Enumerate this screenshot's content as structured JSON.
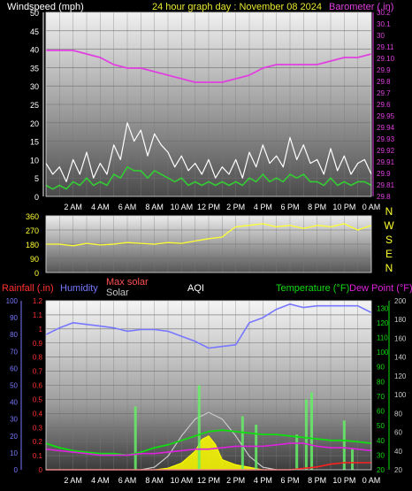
{
  "title": "24 hour graph day : November 08 2024",
  "colors": {
    "background": "#000000",
    "wind": "#ffffff",
    "wind_avg": "#33cc33",
    "barometer": "#e040e0",
    "direction": "#ffff33",
    "rain": "#ff2020",
    "humidity": "#7777ff",
    "max_solar": "#c8c8c8",
    "solar": "#ffff00",
    "aqi": "#ffffff",
    "temperature": "#11dd11",
    "dew_point": "#dd22dd",
    "uv_bar": "#66ee66"
  },
  "chart_data": [
    {
      "type": "line",
      "title": "24 hour graph day : November 08 2024",
      "left_axis_label": "Windspeed (mph)",
      "right_axis_label": "Barometer (.in)",
      "x_ticks": [
        "2 AM",
        "4 AM",
        "6 AM",
        "8 AM",
        "10 AM",
        "12 PM",
        "2 PM",
        "4 PM",
        "6 PM",
        "8 PM",
        "10 PM",
        "0 AM"
      ],
      "x_range_hours": [
        0,
        24
      ],
      "ylim_left": [
        0,
        50
      ],
      "yticks_left": [
        "0",
        "5",
        "10",
        "15",
        "20",
        "25",
        "30",
        "35",
        "40",
        "45",
        "50"
      ],
      "ylim_right": [
        29.8,
        30.3
      ],
      "yticks_right": [
        "29.8",
        "29.81",
        "29.9",
        "29.91",
        "29.92",
        "29.93",
        "29.94",
        "29.95",
        "29.6",
        "29.7",
        "29.8",
        "29.9",
        "29.10",
        "29.11",
        "30",
        "30.1",
        "30.2"
      ],
      "series": [
        {
          "name": "wind_gust",
          "x": [
            0,
            0.5,
            1,
            1.5,
            2,
            2.5,
            3,
            3.5,
            4,
            4.5,
            5,
            5.5,
            6,
            6.5,
            7,
            7.5,
            8,
            8.5,
            9,
            9.5,
            10,
            10.5,
            11,
            11.5,
            12,
            12.5,
            13,
            13.5,
            14,
            14.5,
            15,
            15.5,
            16,
            16.5,
            17,
            17.5,
            18,
            18.5,
            19,
            19.5,
            20,
            20.5,
            21,
            21.5,
            22,
            22.5,
            23,
            23.5,
            24
          ],
          "values": [
            9,
            6,
            8,
            4,
            10,
            6,
            12,
            5,
            9,
            6,
            14,
            10,
            20,
            15,
            18,
            11,
            17,
            14,
            12,
            8,
            11,
            7,
            9,
            6,
            10,
            5,
            8,
            6,
            10,
            5,
            12,
            8,
            14,
            9,
            11,
            8,
            16,
            10,
            14,
            9,
            10,
            6,
            13,
            7,
            11,
            6,
            9,
            10,
            6
          ]
        },
        {
          "name": "wind_avg",
          "x": [
            0,
            0.5,
            1,
            1.5,
            2,
            2.5,
            3,
            3.5,
            4,
            4.5,
            5,
            5.5,
            6,
            6.5,
            7,
            7.5,
            8,
            8.5,
            9,
            9.5,
            10,
            10.5,
            11,
            11.5,
            12,
            12.5,
            13,
            13.5,
            14,
            14.5,
            15,
            15.5,
            16,
            16.5,
            17,
            17.5,
            18,
            18.5,
            19,
            19.5,
            20,
            20.5,
            21,
            21.5,
            22,
            22.5,
            23,
            23.5,
            24
          ],
          "values": [
            3,
            2,
            3,
            2,
            4,
            3,
            5,
            3,
            4,
            3,
            6,
            5,
            8,
            7,
            7,
            5,
            7,
            6,
            5,
            4,
            5,
            3,
            4,
            3,
            4,
            3,
            4,
            3,
            4,
            3,
            5,
            4,
            6,
            4,
            5,
            4,
            6,
            5,
            6,
            4,
            4,
            3,
            5,
            3,
            4,
            3,
            4,
            4,
            3
          ]
        },
        {
          "name": "barometer",
          "x": [
            0,
            1,
            2,
            3,
            4,
            5,
            6,
            7,
            8,
            9,
            10,
            11,
            12,
            13,
            14,
            15,
            16,
            17,
            18,
            19,
            20,
            21,
            22,
            23,
            24
          ],
          "values": [
            29.9,
            29.9,
            29.9,
            29.89,
            29.88,
            29.86,
            29.85,
            29.85,
            29.84,
            29.83,
            29.82,
            29.81,
            29.81,
            29.81,
            29.82,
            29.83,
            29.85,
            29.86,
            29.86,
            29.86,
            29.86,
            29.87,
            29.88,
            29.88,
            29.89
          ]
        }
      ]
    },
    {
      "type": "line",
      "right_labels": [
        "N",
        "W",
        "S",
        "E",
        "N"
      ],
      "yticks_left": [
        "360",
        "270",
        "180",
        "90",
        "0"
      ],
      "ylim": [
        0,
        360
      ],
      "series": [
        {
          "name": "wind_direction",
          "x": [
            0,
            1,
            2,
            3,
            4,
            5,
            6,
            7,
            8,
            9,
            10,
            11,
            12,
            13,
            13.5,
            14,
            15,
            16,
            17,
            18,
            19,
            20,
            21,
            22,
            23,
            24
          ],
          "values": [
            180,
            180,
            170,
            185,
            175,
            180,
            190,
            185,
            180,
            190,
            185,
            200,
            215,
            225,
            260,
            290,
            300,
            310,
            290,
            300,
            280,
            300,
            290,
            310,
            270,
            300
          ]
        }
      ]
    },
    {
      "type": "line",
      "legend": [
        "Rainfall (.in)",
        "Humidity",
        "Max solar",
        "Solar",
        "AQI",
        "Temperature (°F)",
        "Dew Point (°F)"
      ],
      "x_ticks": [
        "2 AM",
        "4 AM",
        "6 AM",
        "8 AM",
        "10 AM",
        "12 PM",
        "2 PM",
        "4 PM",
        "6 PM",
        "8 PM",
        "10 PM",
        "0 AM"
      ],
      "yticks_rain": [
        "0",
        "0.1",
        "0.2",
        "0.3",
        "0.4",
        "0.5",
        "0.6",
        "0.7",
        "0.8",
        "0.9",
        "1",
        "1.1",
        "1.2"
      ],
      "yticks_humidity": [
        "0",
        "10",
        "20",
        "30",
        "40",
        "50",
        "60",
        "70",
        "80",
        "90",
        "100"
      ],
      "yticks_solar": [
        "20",
        "40",
        "60",
        "80",
        "100",
        "120",
        "140",
        "160",
        "180",
        "200"
      ],
      "yticks_temp": [
        "20",
        "30",
        "40",
        "50",
        "60",
        "70",
        "80",
        "90",
        "100",
        "110",
        "120",
        "130"
      ],
      "ylim_rain": [
        0,
        1.2
      ],
      "ylim_humidity": [
        0,
        100
      ],
      "ylim_temp": [
        20,
        135
      ],
      "series": [
        {
          "name": "Humidity",
          "x": [
            0,
            1,
            2,
            3,
            4,
            5,
            6,
            7,
            8,
            9,
            10,
            11,
            12,
            13,
            14,
            15,
            16,
            17,
            18,
            19,
            20,
            21,
            22,
            23,
            24
          ],
          "values": [
            80,
            84,
            87,
            86,
            85,
            84,
            82,
            83,
            83,
            82,
            79,
            76,
            72,
            73,
            74,
            87,
            90,
            95,
            98,
            96,
            97,
            97,
            97,
            97,
            93
          ]
        },
        {
          "name": "Temperature (°F)",
          "x": [
            0,
            1,
            2,
            3,
            4,
            5,
            6,
            7,
            8,
            9,
            10,
            11,
            12,
            13,
            14,
            15,
            16,
            17,
            18,
            19,
            20,
            21,
            22,
            23,
            24
          ],
          "values": [
            38,
            35,
            33,
            32,
            31,
            31,
            30,
            32,
            35,
            37,
            40,
            43,
            46,
            47,
            46,
            45,
            44,
            44,
            43,
            42,
            41,
            40,
            40,
            39,
            38
          ]
        },
        {
          "name": "Dew Point (°F)",
          "x": [
            0,
            1,
            2,
            3,
            4,
            5,
            6,
            7,
            8,
            9,
            10,
            11,
            12,
            13,
            14,
            15,
            16,
            17,
            18,
            19,
            20,
            21,
            22,
            23,
            24
          ],
          "values": [
            34,
            33,
            32,
            31,
            30,
            30,
            30,
            31,
            31,
            32,
            33,
            34,
            34,
            35,
            36,
            36,
            36,
            37,
            38,
            38,
            36,
            35,
            35,
            34,
            33
          ]
        },
        {
          "name": "Max solar",
          "x": [
            7,
            8,
            9,
            10,
            11,
            12,
            13,
            14,
            15,
            16,
            17
          ],
          "values": [
            0,
            15,
            80,
            200,
            300,
            340,
            300,
            200,
            80,
            15,
            0
          ]
        },
        {
          "name": "Solar",
          "x": [
            8,
            9,
            10,
            11,
            11.5,
            12,
            12.5,
            13,
            14,
            15,
            16
          ],
          "values": [
            0,
            10,
            40,
            110,
            180,
            200,
            150,
            60,
            30,
            15,
            0
          ]
        },
        {
          "name": "Rainfall (.in)",
          "x": [
            0,
            12,
            18,
            19,
            20,
            21,
            22,
            23,
            24
          ],
          "values": [
            0,
            0,
            0,
            0.01,
            0.02,
            0.04,
            0.05,
            0.05,
            0.05
          ]
        }
      ]
    }
  ]
}
